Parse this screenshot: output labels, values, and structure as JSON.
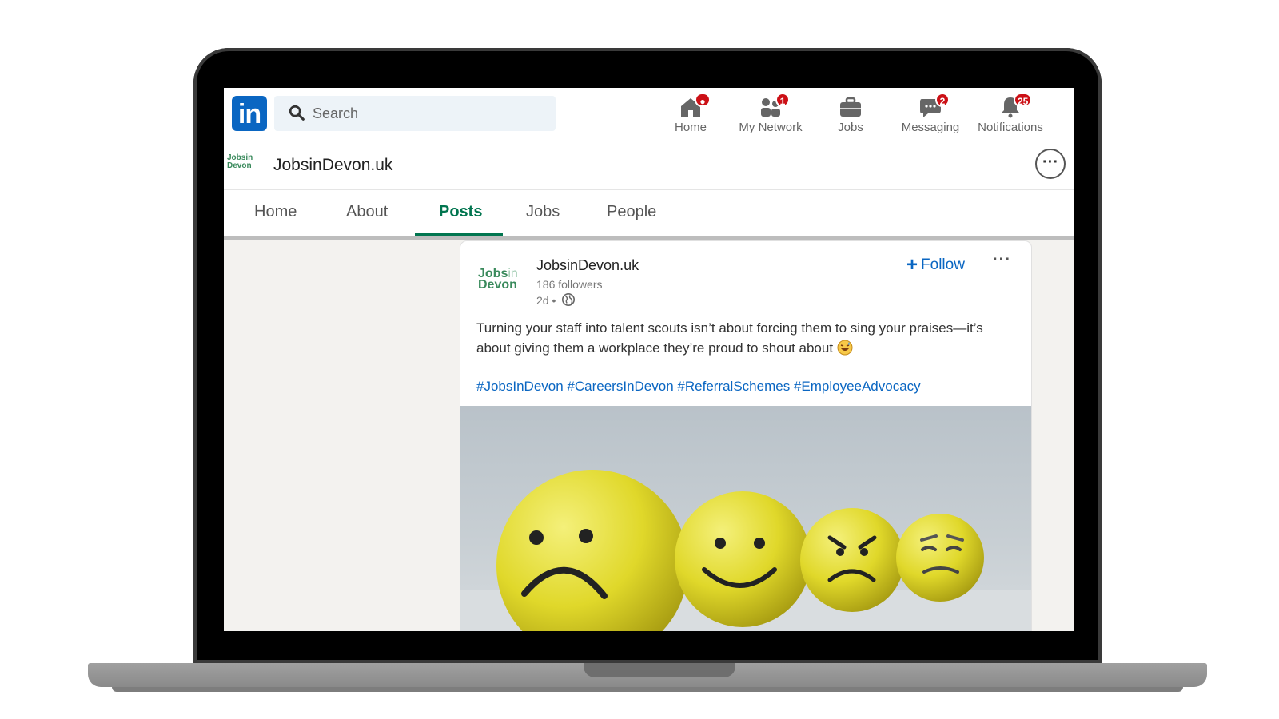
{
  "topnav": {
    "logo_text": "in",
    "search": {
      "placeholder": "Search"
    },
    "items": [
      {
        "label": "Home",
        "badge": ""
      },
      {
        "label": "My Network",
        "badge": "1"
      },
      {
        "label": "Jobs",
        "badge": ""
      },
      {
        "label": "Messaging",
        "badge": "2"
      },
      {
        "label": "Notifications",
        "badge": "25"
      }
    ],
    "icons": [
      "home-icon",
      "my-network-icon",
      "jobs-icon",
      "messaging-icon",
      "notifications-icon"
    ]
  },
  "company": {
    "logo_text": "JobsinDevon",
    "name": "JobsinDevon.uk",
    "more_icon": "ellipsis-icon"
  },
  "tabs": [
    {
      "label": "Home"
    },
    {
      "label": "About"
    },
    {
      "label": "Posts",
      "active": true
    },
    {
      "label": "Jobs"
    },
    {
      "label": "People"
    }
  ],
  "post": {
    "logo_line1": "Jobs",
    "logo_line1_light": "in",
    "logo_line2": "Devon",
    "author": "JobsinDevon.uk",
    "followers": "186 followers",
    "time": "2d •",
    "follow_label": "Follow",
    "text": "Turning your staff into talent scouts isn’t about forcing them to sing your praises—it’s about giving them a workplace they’re proud to shout about",
    "hashtags": [
      "#JobsInDevon",
      "#CareersInDevon",
      "#ReferralSchemes",
      "#EmployeeAdvocacy"
    ],
    "image_icon": "emoji-faces-image"
  },
  "colors": {
    "linkedin_blue": "#0a66c2",
    "active_tab_green": "#01754f",
    "badge_red": "#cc1016"
  }
}
